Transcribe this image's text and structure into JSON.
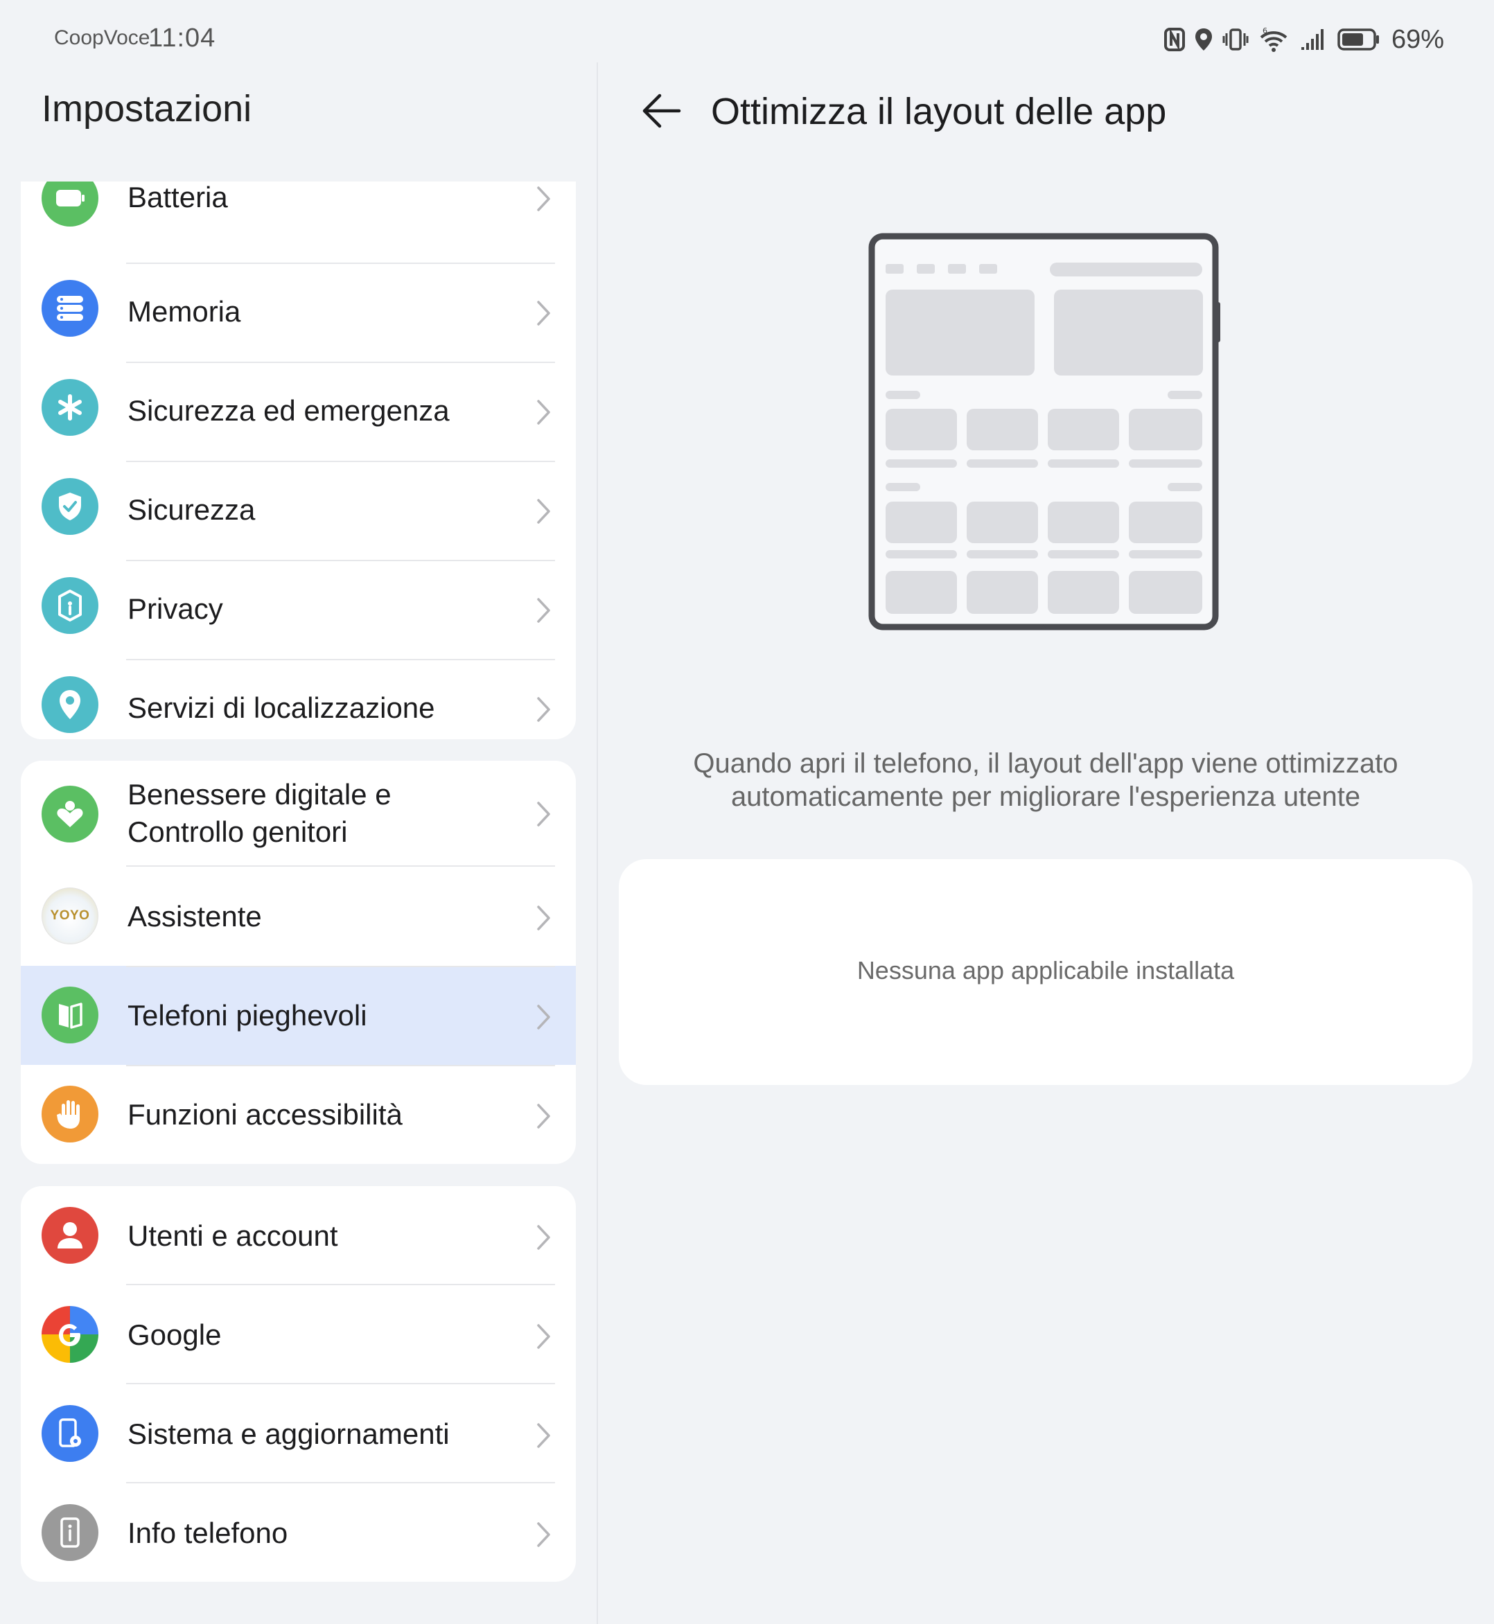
{
  "status_bar": {
    "carrier": "CoopVoce",
    "time": "11:04",
    "battery_percent": "69%",
    "icons": [
      "nfc-icon",
      "location-icon",
      "vibrate-icon",
      "wifi-6-icon",
      "signal-icon",
      "battery-icon"
    ]
  },
  "left_pane": {
    "title": "Impostazioni",
    "groups": [
      {
        "items": [
          {
            "label": "Batteria",
            "icon": "battery-icon",
            "color": "#5bbf63"
          },
          {
            "label": "Memoria",
            "icon": "storage-icon",
            "color": "#3d7ef0"
          },
          {
            "label": "Sicurezza ed emergenza",
            "icon": "asterisk-icon",
            "color": "#4fbcc8"
          },
          {
            "label": "Sicurezza",
            "icon": "shield-check-icon",
            "color": "#4fbcc8"
          },
          {
            "label": "Privacy",
            "icon": "privacy-lock-icon",
            "color": "#4fbcc8"
          },
          {
            "label": "Servizi di localizzazione",
            "icon": "location-pin-icon",
            "color": "#4fbcc8"
          }
        ]
      },
      {
        "items": [
          {
            "label_line1": "Benessere digitale e",
            "label_line2": "Controllo genitori",
            "icon": "heart-person-icon",
            "color": "#5bbf63"
          },
          {
            "label": "Assistente",
            "icon": "yoyo-assistant-icon",
            "icon_text": "YOYO",
            "color": "#f4f1e6"
          },
          {
            "label": "Telefoni pieghevoli",
            "icon": "foldable-phone-icon",
            "color": "#5bbf63",
            "selected": true
          },
          {
            "label": "Funzioni accessibilità",
            "icon": "hand-icon",
            "color": "#f19a37"
          }
        ]
      },
      {
        "items": [
          {
            "label": "Utenti e account",
            "icon": "user-icon",
            "color": "#e0483e"
          },
          {
            "label": "Google",
            "icon": "google-icon",
            "color": "#4285f4"
          },
          {
            "label": "Sistema e aggiornamenti",
            "icon": "system-update-icon",
            "color": "#3d7ef0"
          },
          {
            "label": "Info telefono",
            "icon": "phone-info-icon",
            "color": "#9a9a9a"
          }
        ]
      }
    ]
  },
  "right_pane": {
    "title": "Ottimizza il layout delle app",
    "description_line1": "Quando apri il telefono, il layout dell'app viene ottimizzato",
    "description_line2": "automaticamente per migliorare l'esperienza utente",
    "empty_message": "Nessuna app applicabile installata"
  }
}
